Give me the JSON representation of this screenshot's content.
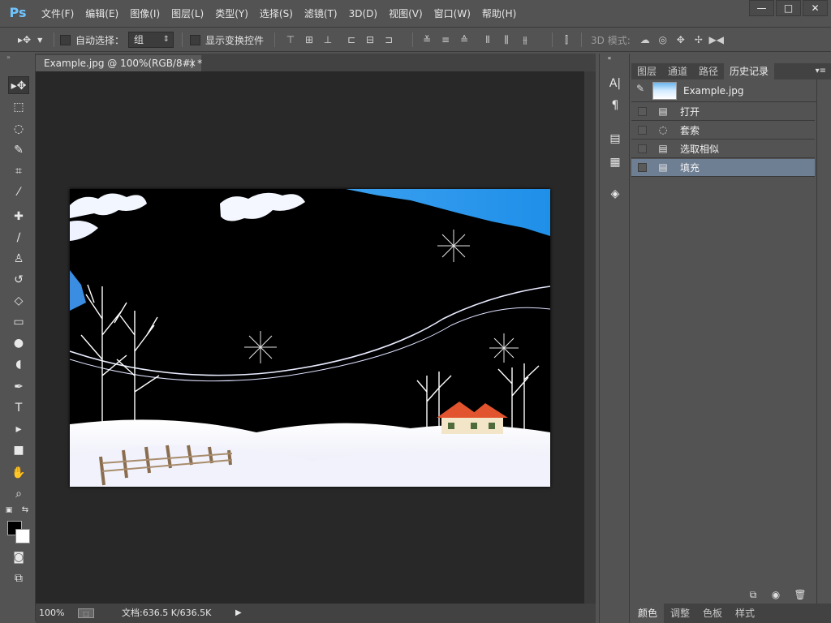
{
  "app": {
    "logo": "Ps",
    "menu": [
      "文件(F)",
      "编辑(E)",
      "图像(I)",
      "图层(L)",
      "类型(Y)",
      "选择(S)",
      "滤镜(T)",
      "3D(D)",
      "视图(V)",
      "窗口(W)",
      "帮助(H)"
    ],
    "window_controls": {
      "minimize": "—",
      "restore": "□",
      "close": "✕"
    }
  },
  "options": {
    "move_tool_icon": "▸✥",
    "auto_select_label": "自动选择：",
    "auto_select_value": "组",
    "show_transform_label": "显示变换控件",
    "mode_3d_label": "3D 模式:"
  },
  "document": {
    "tab_title": "Example.jpg @ 100%(RGB/8#) *",
    "tab_close": "×",
    "zoom": "100%",
    "doc_info": "文档:636.5 K/636.5K"
  },
  "history": {
    "tabs": [
      "图层",
      "通道",
      "路径",
      "历史记录"
    ],
    "active_tab": "历史记录",
    "snapshot_name": "Example.jpg",
    "items": [
      {
        "label": "打开",
        "icon": "document-icon"
      },
      {
        "label": "套索",
        "icon": "lasso-icon"
      },
      {
        "label": "选取相似",
        "icon": "document-icon"
      },
      {
        "label": "填充",
        "icon": "document-icon",
        "selected": true
      }
    ]
  },
  "bottom_tabs": [
    "颜色",
    "调整",
    "色板",
    "样式"
  ],
  "colors": {
    "foreground": "#000000",
    "background": "#ffffff",
    "selection_highlight": "#6e7f94",
    "ps_blue": "#6ec4ff"
  }
}
